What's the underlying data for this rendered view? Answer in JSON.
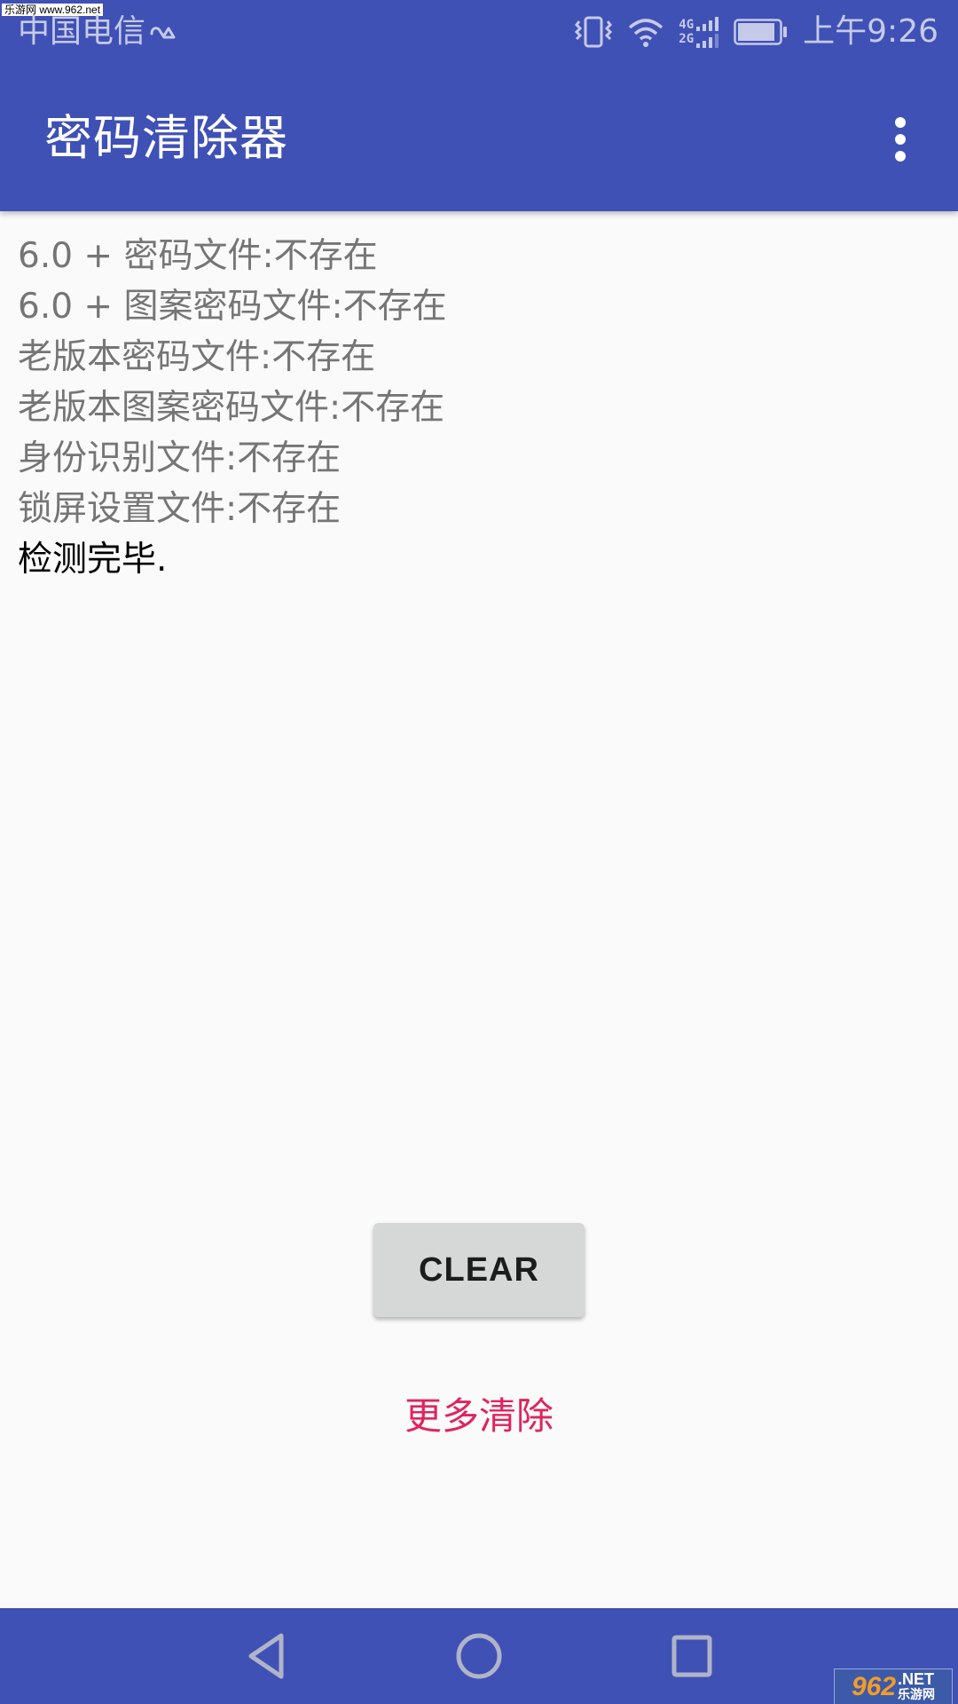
{
  "status_bar": {
    "watermark": "乐游网 www.962.net",
    "carrier": "中国电信",
    "hd_icon": "hd-voice-icon",
    "icons": [
      "vibrate-icon",
      "wifi-icon",
      "signal-icon",
      "battery-icon"
    ],
    "network_types": [
      "4G",
      "2G"
    ],
    "time": "上午9:26",
    "battery_level": 0.9
  },
  "toolbar": {
    "title": "密码清除器",
    "overflow_icon": "more-vert-icon"
  },
  "results": {
    "lines": [
      "6.0 + 密码文件:不存在",
      "6.0 + 图案密码文件:不存在",
      "老版本密码文件:不存在",
      "老版本图案密码文件:不存在",
      "身份识别文件:不存在",
      "锁屏设置文件:不存在"
    ],
    "done": "检测完毕."
  },
  "actions": {
    "clear_label": "CLEAR",
    "more_label": "更多清除"
  },
  "navbar": {
    "icons": [
      "back-icon",
      "home-icon",
      "recents-icon"
    ]
  },
  "watermark_bottom": {
    "number": "962",
    "net": ".NET",
    "cn": "乐游网"
  },
  "colors": {
    "primary": "#3f51b5",
    "accent": "#e0245e",
    "background": "#fafafa",
    "text_secondary": "#757575",
    "button_bg": "#d6d7d7"
  }
}
